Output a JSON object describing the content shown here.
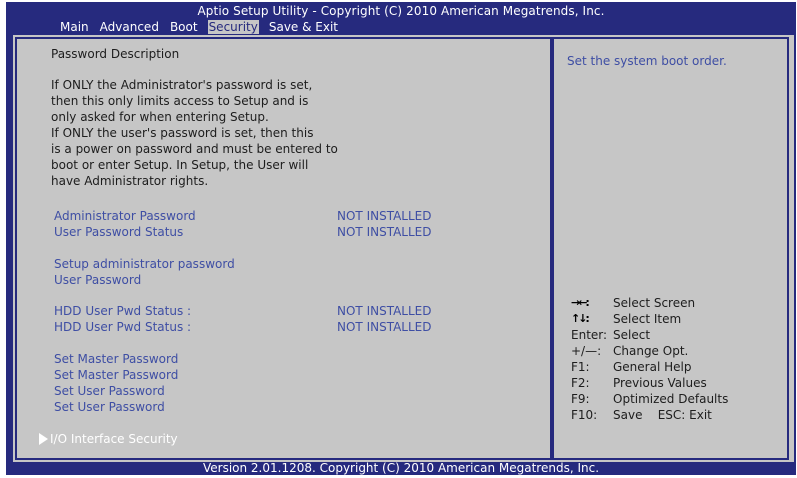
{
  "header": {
    "title": "Aptio Setup Utility - Copyright (C) 2010 American Megatrends, Inc."
  },
  "tabs": [
    {
      "label": "Main"
    },
    {
      "label": "Advanced"
    },
    {
      "label": "Boot"
    },
    {
      "label": "Security",
      "active": true
    },
    {
      "label": "Save & Exit"
    }
  ],
  "main": {
    "description_title": "Password Description",
    "description_lines": [
      "If ONLY the Administrator's password is set,",
      "then this only limits access to Setup and is",
      "only asked for when entering Setup.",
      "If ONLY the user's password is set, then this",
      "is a power on password and must be entered to",
      "boot or enter Setup. In Setup, the User will",
      "have Administrator rights."
    ],
    "admin_password": {
      "label": "Administrator Password",
      "value": "NOT INSTALLED"
    },
    "user_password_status": {
      "label": "User Password Status",
      "value": "NOT INSTALLED"
    },
    "setup_admin_password": "Setup administrator password",
    "user_password": "User Password",
    "hdd_status_1": {
      "label": "HDD User Pwd Status :",
      "value": "NOT INSTALLED"
    },
    "hdd_status_2": {
      "label": "HDD User Pwd Status :",
      "value": "NOT INSTALLED"
    },
    "set_master_1": "Set Master Password",
    "set_master_2": "Set Master Password",
    "set_user_1": "Set User Password",
    "set_user_2": "Set User Password",
    "io_security": "I/O Interface Security"
  },
  "help": {
    "text": "Set the system boot order.",
    "keys": [
      {
        "key": "→←:",
        "desc": "Select Screen"
      },
      {
        "key": "↑↓:",
        "desc": "Select Item"
      },
      {
        "key": "Enter:",
        "desc": "Select"
      },
      {
        "key": "+/—:",
        "desc": "Change Opt."
      },
      {
        "key": "F1:",
        "desc": "General Help"
      },
      {
        "key": "F2:",
        "desc": "Previous Values"
      },
      {
        "key": "F9:",
        "desc": "Optimized Defaults"
      },
      {
        "key": "F10:",
        "desc": "Save    ESC: Exit"
      }
    ]
  },
  "footer": {
    "text": "Version 2.01.1208. Copyright (C) 2010 American Megatrends, Inc."
  },
  "colors": {
    "frame": "#262a7e",
    "panel": "#c6c6c6",
    "item_text": "#3e4ea4",
    "body_text": "#1d1d1d"
  }
}
